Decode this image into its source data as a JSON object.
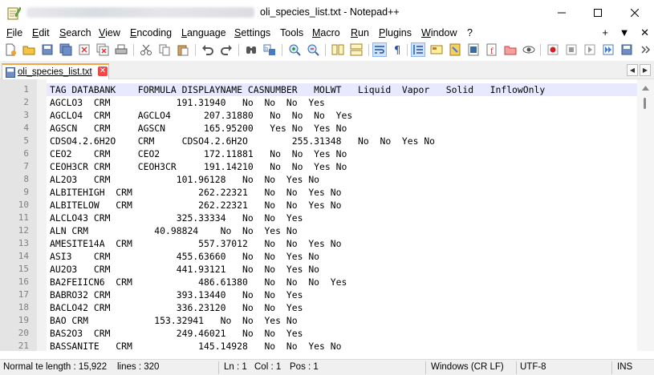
{
  "window": {
    "title": "oli_species_list.txt - Notepad++",
    "min_icon": "minimize-icon",
    "max_icon": "maximize-icon",
    "close_icon": "close-icon"
  },
  "menu": {
    "items": [
      "File",
      "Edit",
      "Search",
      "View",
      "Encoding",
      "Language",
      "Settings",
      "Tools",
      "Macro",
      "Run",
      "Plugins",
      "Window",
      "?"
    ],
    "right": [
      "+",
      "▼",
      "✕"
    ]
  },
  "tab": {
    "label": "oli_species_list.txt",
    "accent_color": "#f5a442",
    "close_color": "#f04747"
  },
  "editor": {
    "line_numbers": [
      "1",
      "2",
      "3",
      "4",
      "5",
      "6",
      "7",
      "8",
      "9",
      "10",
      "11",
      "12",
      "13",
      "14",
      "15",
      "16",
      "17",
      "18",
      "19",
      "20",
      "21"
    ],
    "lines": [
      "TAG DATABANK    FORMULA DISPLAYNAME CASNUMBER   MOLWT   Liquid  Vapor   Solid   InflowOnly",
      "AGCLO3  CRM            191.31940   No  No  No  Yes",
      "AGCLO4  CRM     AGCLO4      207.31880   No  No  No  Yes",
      "AGSCN   CRM     AGSCN       165.95200   Yes No  Yes No",
      "CDSO4.2.6H2O    CRM     CDSO4.2.6H2O        255.31348   No  No  Yes No",
      "CEO2    CRM     CEO2        172.11881   No  No  Yes No",
      "CEOH3CR CRM     CEOH3CR     191.14210   No  No  Yes No",
      "AL2O3   CRM            101.96128   No  No  Yes No",
      "ALBITEHIGH  CRM            262.22321   No  No  Yes No",
      "ALBITELOW   CRM            262.22321   No  No  Yes No",
      "ALCLO43 CRM            325.33334   No  No  Yes",
      "ALN CRM            40.98824    No  No  Yes No",
      "AMESITE14A  CRM            557.37012   No  No  Yes No",
      "ASI3    CRM            455.63660   No  No  Yes No",
      "AU2O3   CRM            441.93121   No  No  Yes No",
      "BA2FEIICN6  CRM            486.61380   No  No  No  Yes",
      "BABRO32 CRM            393.13440   No  No  Yes",
      "BACLO42 CRM            336.23120   No  No  Yes",
      "BAO CRM            153.32941   No  No  Yes No",
      "BAS2O3  CRM            249.46021   No  No  Yes",
      "BASSANITE   CRM            145.14928   No  No  Yes No"
    ]
  },
  "status": {
    "doc_type": "Normal te",
    "length": "length : 15,922",
    "lines": "lines : 320",
    "ln": "Ln : 1",
    "col": "Col : 1",
    "pos": "Pos : 1",
    "eol": "Windows (CR LF)",
    "encoding": "UTF-8",
    "mode": "INS"
  }
}
